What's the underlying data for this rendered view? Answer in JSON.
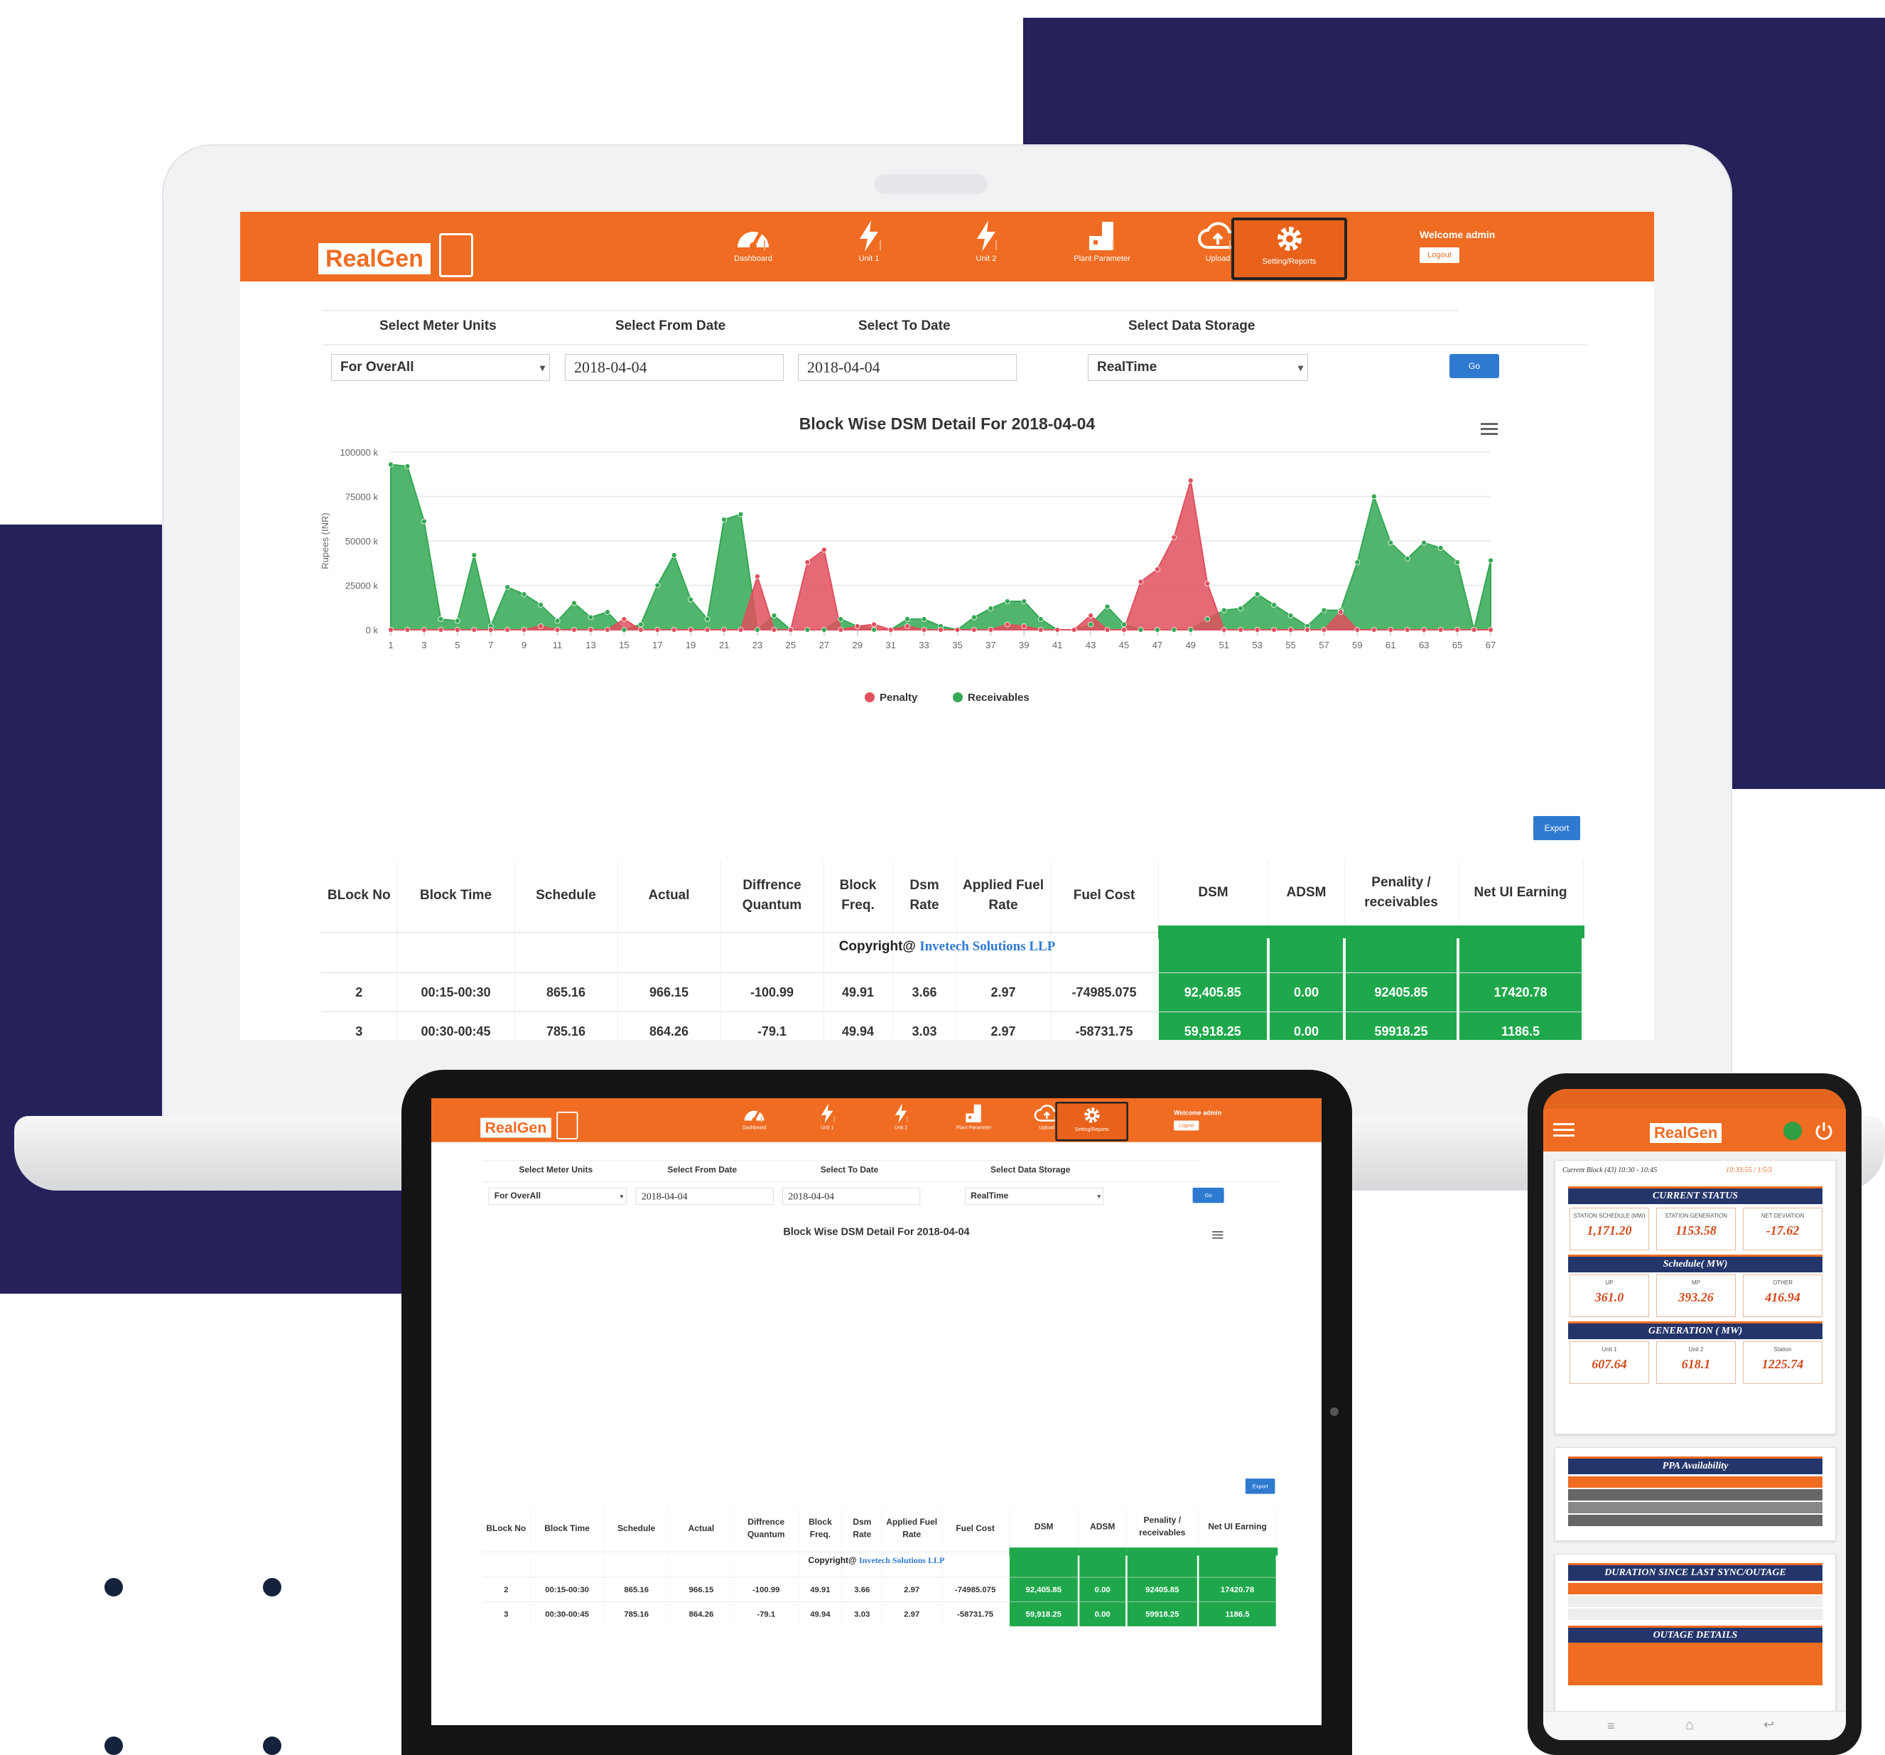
{
  "app": {
    "logo": "RealGen",
    "nav": [
      {
        "label": "Dashboard",
        "icon": "speedometer-icon"
      },
      {
        "label": "Unit 1",
        "icon": "lightning-icon"
      },
      {
        "label": "Unit 2",
        "icon": "lightning-icon"
      },
      {
        "label": "Plant Parameter",
        "icon": "plant-icon"
      },
      {
        "label": "Upload",
        "icon": "cloud-upload-icon"
      },
      {
        "label": "Setting/Reports",
        "icon": "gear-icon"
      }
    ],
    "welcome": "Welcome admin",
    "logout": "Logout",
    "filters": {
      "meter_units_label": "Select Meter Units",
      "meter_units_value": "For OverAll",
      "from_date_label": "Select From Date",
      "from_date_value": "2018-04-04",
      "to_date_label": "Select To Date",
      "to_date_value": "2018-04-04",
      "storage_label": "Select Data Storage",
      "storage_value": "RealTime",
      "go": "Go"
    },
    "export": "Export",
    "table": {
      "headers": [
        "BLock No",
        "Block Time",
        "Schedule",
        "Actual",
        "Diffrence Quantum",
        "Block Freq.",
        "Dsm Rate",
        "Applied Fuel Rate",
        "Fuel Cost",
        "DSM",
        "ADSM",
        "Penality / receivables",
        "Net UI Earning"
      ],
      "rows": [
        [
          "2",
          "00:15-00:30",
          "865.16",
          "966.15",
          "-100.99",
          "49.91",
          "3.66",
          "2.97",
          "-74985.075",
          "92,405.85",
          "0.00",
          "92405.85",
          "17420.78"
        ],
        [
          "3",
          "00:30-00:45",
          "785.16",
          "864.26",
          "-79.1",
          "49.94",
          "3.03",
          "2.97",
          "-58731.75",
          "59,918.25",
          "0.00",
          "59918.25",
          "1186.5"
        ]
      ]
    },
    "copyright_prefix": "Copyright@",
    "copyright_company": "Invetech Solutions LLP"
  },
  "chart_data": {
    "type": "area",
    "title": "Block Wise DSM Detail For 2018-04-04",
    "ylabel": "Rupees (INR)",
    "xlabel": "",
    "ylim": [
      0,
      100000
    ],
    "yticks": [
      "0 k",
      "25000 k",
      "50000 k",
      "75000 k",
      "100000 k"
    ],
    "x": [
      1,
      2,
      3,
      4,
      5,
      6,
      7,
      8,
      9,
      10,
      11,
      12,
      13,
      14,
      15,
      16,
      17,
      18,
      19,
      20,
      21,
      22,
      23,
      24,
      25,
      26,
      27,
      28,
      29,
      30,
      31,
      32,
      33,
      34,
      35,
      36,
      37,
      38,
      39,
      40,
      41,
      42,
      43,
      44,
      45,
      46,
      47,
      48,
      49,
      50,
      51,
      52,
      53,
      54,
      55,
      56,
      57,
      58,
      59,
      60,
      61,
      62,
      63,
      64,
      65,
      66,
      67
    ],
    "x_tick_labels": [
      "1",
      "3",
      "5",
      "7",
      "9",
      "11",
      "13",
      "15",
      "17",
      "19",
      "21",
      "23",
      "25",
      "27",
      "29",
      "31",
      "33",
      "35",
      "37",
      "39",
      "41",
      "43",
      "45",
      "47",
      "49",
      "51",
      "53",
      "55",
      "57",
      "59",
      "61",
      "63",
      "65",
      "67"
    ],
    "series": [
      {
        "name": "Penalty",
        "color": "#e0505e",
        "values": [
          0,
          0,
          0,
          0,
          0,
          0,
          0,
          0,
          0,
          2000,
          0,
          0,
          0,
          0,
          6000,
          0,
          0,
          0,
          0,
          0,
          0,
          0,
          30000,
          0,
          0,
          38000,
          45000,
          0,
          2000,
          3000,
          0,
          2000,
          0,
          0,
          0,
          0,
          0,
          3000,
          2000,
          0,
          0,
          0,
          8000,
          0,
          0,
          27000,
          34000,
          52000,
          84000,
          26000,
          0,
          0,
          0,
          0,
          0,
          0,
          0,
          10000,
          0,
          0,
          0,
          0,
          0,
          0,
          0,
          0,
          0
        ]
      },
      {
        "name": "Receivables",
        "color": "#34a853",
        "values": [
          93000,
          92000,
          61000,
          6000,
          5000,
          42000,
          2000,
          24000,
          20000,
          14000,
          5000,
          15000,
          7000,
          10000,
          0,
          3000,
          25000,
          42000,
          17000,
          6000,
          62000,
          65000,
          0,
          8000,
          0,
          0,
          0,
          6000,
          2000,
          0,
          0,
          6000,
          6000,
          2000,
          0,
          7000,
          12000,
          16000,
          16000,
          6000,
          0,
          0,
          3000,
          13000,
          3000,
          0,
          0,
          0,
          0,
          6000,
          11000,
          12000,
          20000,
          14000,
          8000,
          2000,
          11000,
          11000,
          38000,
          75000,
          49000,
          40000,
          49000,
          46000,
          38000,
          0,
          39000
        ]
      }
    ],
    "legend": [
      "Penalty",
      "Receivables"
    ],
    "legend_position": "bottom-center",
    "grid": true
  },
  "phone": {
    "logo": "RealGen",
    "current_block": "Current Block (43) 10:30 - 10:45",
    "current_block_time": "10:33:55 / 1/5/3",
    "current_status_title": "CURRENT STATUS",
    "status": [
      {
        "k": "STATION SCHEDULE (MW)",
        "v": "1,171.20"
      },
      {
        "k": "STATION GENERATION",
        "v": "1153.58"
      },
      {
        "k": "NET DEVIATION",
        "v": "-17.62"
      }
    ],
    "schedule_title": "Schedule( MW)",
    "schedule": [
      {
        "k": "UP",
        "v": "361.0"
      },
      {
        "k": "MP",
        "v": "393.26"
      },
      {
        "k": "OTHER",
        "v": "416.94"
      }
    ],
    "generation_title": "GENERATION ( MW)",
    "generation": [
      {
        "k": "Unit 1",
        "v": "607.64"
      },
      {
        "k": "Unit 2",
        "v": "618.1"
      },
      {
        "k": "Station",
        "v": "1225.74"
      }
    ],
    "ppa_title": "PPA Availability",
    "sync_title": "DURATION SINCE LAST SYNC/OUTAGE",
    "outage_title": "OUTAGE DETAILS"
  }
}
